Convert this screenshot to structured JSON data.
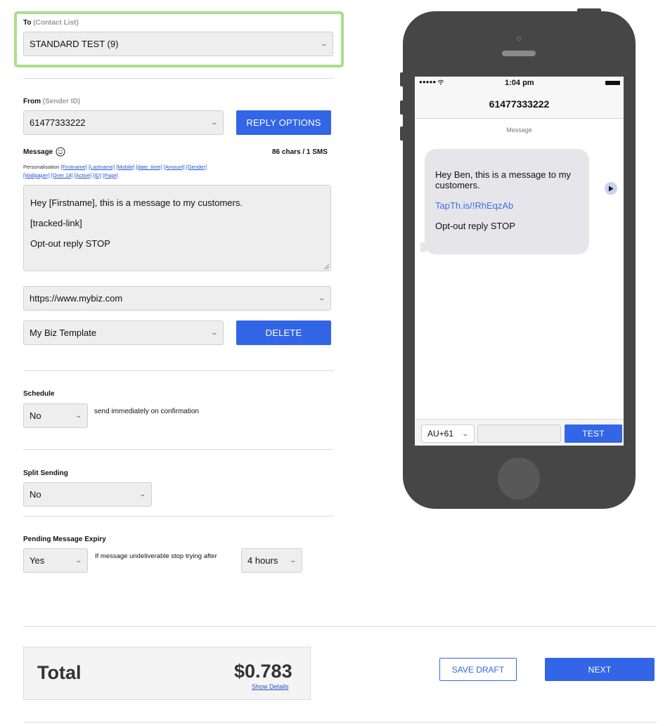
{
  "to": {
    "label": "To",
    "sub": "(Contact List)",
    "value": "STANDARD TEST (9)"
  },
  "from": {
    "label": "From",
    "sub": "(Sender ID)",
    "value": "61477333222",
    "reply_button": "REPLY OPTIONS"
  },
  "message": {
    "label": "Message",
    "counter": "86 chars / 1 SMS",
    "personalisation_label": "Personalisation",
    "tags": [
      "[Firstname]",
      "[Lastname]",
      "[Mobile]",
      "[date_time]",
      "[Amount]",
      "[Gender]",
      "[Wallpaper]",
      "[Over 18]",
      "[Active]",
      "[ID]",
      "[Page]"
    ],
    "lines": [
      "Hey [Firstname], this is a message to my customers.",
      "[tracked-link]",
      "Opt-out reply STOP"
    ]
  },
  "link_select": {
    "value": "https://www.mybiz.com"
  },
  "template": {
    "value": "My Biz Template",
    "delete_button": "DELETE"
  },
  "schedule": {
    "label": "Schedule",
    "value": "No",
    "note": "send immediately on confirmation"
  },
  "split": {
    "label": "Split Sending",
    "value": "No"
  },
  "expiry": {
    "label": "Pending Message Expiry",
    "value": "Yes",
    "note": "If message undeliverable stop trying after",
    "duration": "4 hours"
  },
  "total": {
    "label": "Total",
    "amount": "$0.783",
    "details_link": "Show Details"
  },
  "actions": {
    "save_draft": "SAVE DRAFT",
    "next": "NEXT"
  },
  "phone": {
    "signal": "●●●●● ",
    "time": "1:04 pm",
    "contact": "61477333222",
    "thread_label": "Message",
    "bubble_text": "Hey Ben, this is a message to my customers.",
    "bubble_link": "TapTh.is/!RhEqzAb",
    "bubble_optout": "Opt-out reply STOP",
    "country_code": "AU+61",
    "test_button": "TEST"
  },
  "colors": {
    "accent": "#3366e6",
    "highlight": "#a9df8a",
    "phone_body": "#464646"
  }
}
